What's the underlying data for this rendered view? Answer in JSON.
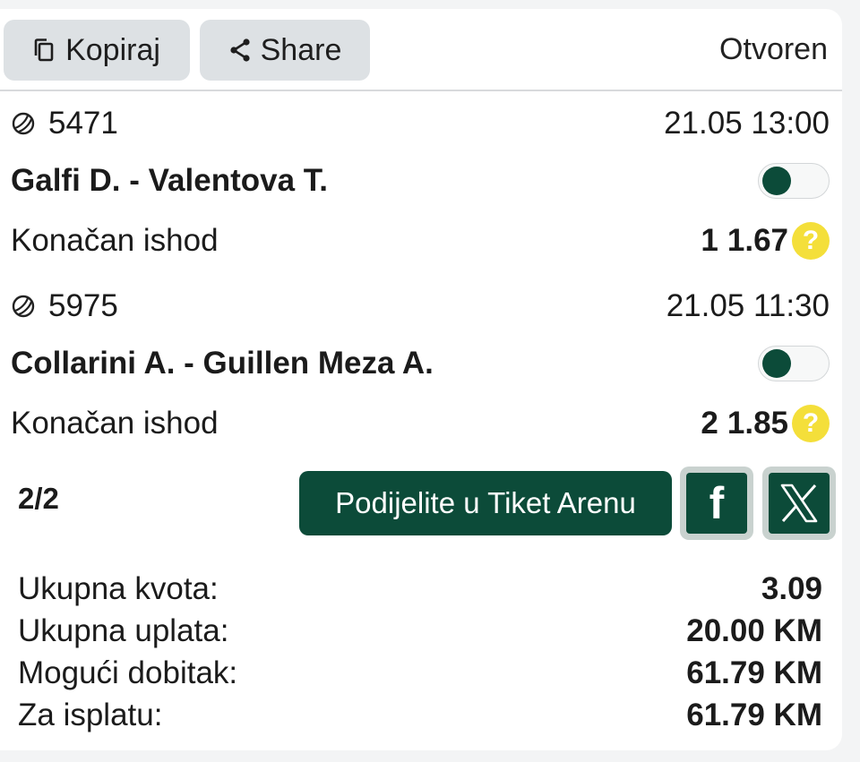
{
  "toolbar": {
    "copy_label": "Kopiraj",
    "share_label": "Share",
    "status": "Otvoren"
  },
  "matches": [
    {
      "code": "5471",
      "datetime": "21.05 13:00",
      "name": "Galfi D. - Valentova T.",
      "market": "Konačan ishod",
      "pick": "1",
      "odds": "1.67",
      "help": "?"
    },
    {
      "code": "5975",
      "datetime": "21.05 11:30",
      "name": "Collarini A. - Guillen Meza A.",
      "market": "Konačan ishod",
      "pick": "2",
      "odds": "1.85",
      "help": "?"
    }
  ],
  "footer": {
    "count": "2/2",
    "share_arena_label": "Podijelite u Tiket Arenu",
    "facebook_glyph": "f"
  },
  "summary": [
    {
      "label": "Ukupna kvota:",
      "value": "3.09"
    },
    {
      "label": "Ukupna uplata:",
      "value": "20.00 KM"
    },
    {
      "label": "Mogući dobitak:",
      "value": "61.79 KM"
    },
    {
      "label": "Za isplatu:",
      "value": "61.79 KM"
    }
  ],
  "colors": {
    "brand_green": "#0c4b39",
    "help_yellow": "#f4df3a",
    "button_gray": "#dde1e4"
  },
  "icons": [
    "copy-icon",
    "share-icon",
    "tennis-ball-icon",
    "facebook-icon",
    "x-logo-icon"
  ]
}
